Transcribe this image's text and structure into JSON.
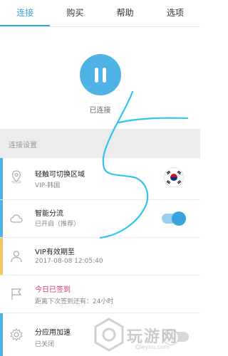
{
  "tabs": [
    {
      "label": "连接"
    },
    {
      "label": "购买"
    },
    {
      "label": "帮助"
    },
    {
      "label": "选项"
    }
  ],
  "connection": {
    "status": "已连接"
  },
  "section": {
    "title": "连接设置"
  },
  "rows": {
    "region": {
      "title": "轻触可切换区域",
      "sub": "VIP-韩国"
    },
    "split": {
      "title": "智能分流",
      "sub": "已开启（推荐）",
      "on": true
    },
    "vip": {
      "title": "VIP有效期至",
      "sub": "2017-08-08 12:05:40"
    },
    "checkin": {
      "title": "今日已签到",
      "sub": "距离下次签到还有：24小时"
    },
    "app_accel": {
      "title": "分应用加速",
      "sub": "已关闭",
      "on": false
    }
  },
  "watermark": {
    "text": "玩游网",
    "url": "Qleyou.com"
  },
  "colors": {
    "accent": "#3aa3de",
    "stripe_blue": "#4fb3e6",
    "stripe_yellow": "#f4c95d",
    "checkin_pink": "#d03a78"
  }
}
